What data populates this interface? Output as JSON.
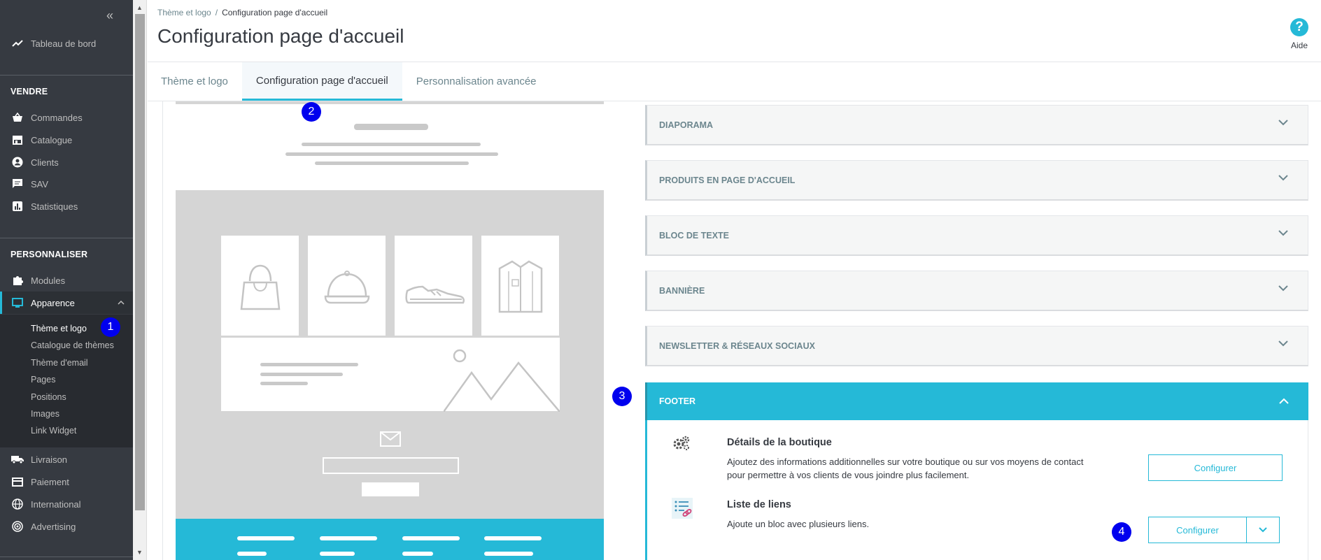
{
  "sidebar": {
    "collapse_icon": "double-chevron-left-icon",
    "dashboard": "Tableau de bord",
    "section_sell": "VENDRE",
    "sell_items": [
      "Commandes",
      "Catalogue",
      "Clients",
      "SAV",
      "Statistiques"
    ],
    "section_customize": "PERSONNALISER",
    "modules": "Modules",
    "appearance": "Apparence",
    "appearance_sub": [
      "Thème et logo",
      "Catalogue de thèmes",
      "Thème d'email",
      "Pages",
      "Positions",
      "Images",
      "Link Widget"
    ],
    "bottom_items": [
      "Livraison",
      "Paiement",
      "International",
      "Advertising"
    ]
  },
  "header": {
    "breadcrumb_parent": "Thème et logo",
    "breadcrumb_sep": "/",
    "breadcrumb_current": "Configuration page d'accueil",
    "title": "Configuration page d'accueil",
    "help_icon": "?",
    "help_label": "Aide"
  },
  "tabs": [
    "Thème et logo",
    "Configuration page d'accueil",
    "Personnalisation avancée"
  ],
  "accordion": {
    "sections": [
      "DIAPORAMA",
      "PRODUITS EN PAGE D'ACCUEIL",
      "BLOC DE TEXTE",
      "BANNIÈRE",
      "NEWSLETTER & RÉSEAUX SOCIAUX"
    ],
    "open_section": "FOOTER",
    "modules": [
      {
        "title": "Détails de la boutique",
        "description": "Ajoutez des informations additionnelles sur votre boutique ou sur vos moyens de contact pour permettre à vos clients de vous joindre plus facilement.",
        "button": "Configurer",
        "icon": "gears-icon"
      },
      {
        "title": "Liste de liens",
        "description": "Ajoute un bloc avec plusieurs liens.",
        "button": "Configurer",
        "icon": "link-list-icon"
      }
    ]
  },
  "markers": [
    "1",
    "2",
    "3",
    "4"
  ],
  "colors": {
    "accent": "#25b9d7",
    "sidebar_bg": "#363a41",
    "marker": "#0000ee"
  }
}
